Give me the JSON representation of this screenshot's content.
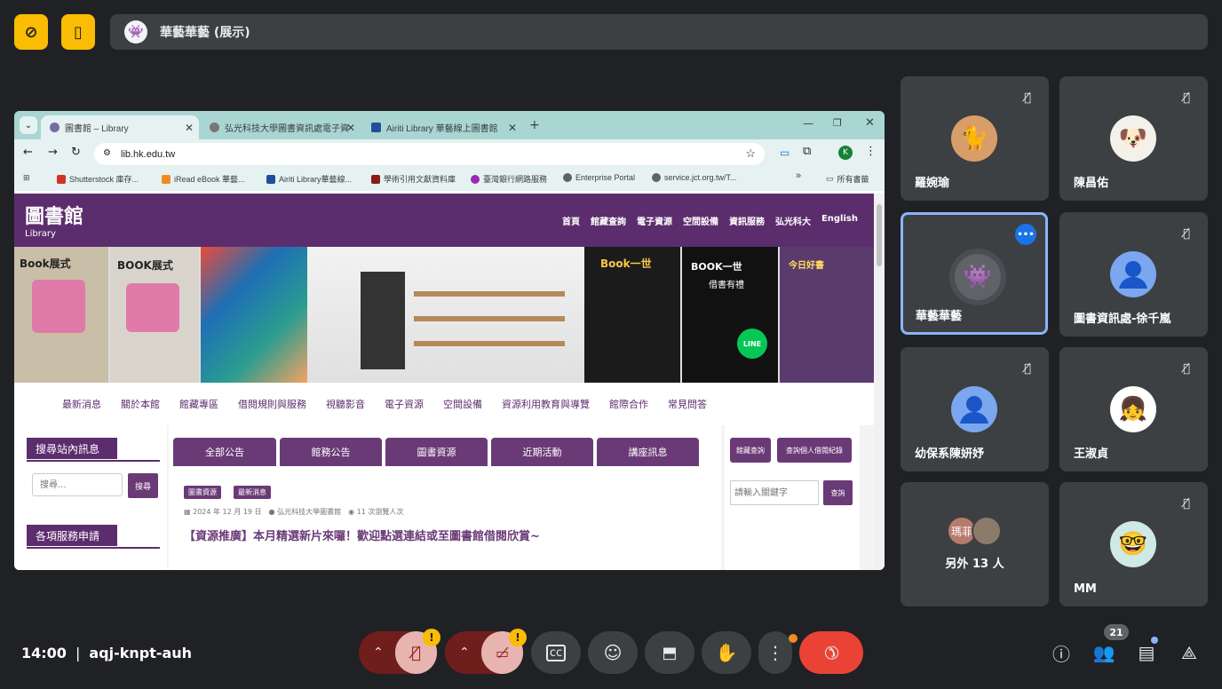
{
  "presenter": {
    "name": "華藝華藝 (展示)"
  },
  "browser": {
    "tabs": [
      {
        "label": "圖書館 – Library"
      },
      {
        "label": "弘光科技大學圖書資訊處電子資"
      },
      {
        "label": "Airiti Library 華藝線上圖書館"
      }
    ],
    "new_tab": "+",
    "url": "lib.hk.edu.tw",
    "bookmarks": [
      "Shutterstock 庫存...",
      "iRead eBook 華藝...",
      "Airiti Library華藝線...",
      "學術引用文獻資料庫",
      "臺灣銀行網路服務",
      "Enterprise Portal",
      "service.jct.org.tw/T..."
    ],
    "bookmarks_more": "»",
    "all_bookmarks": "所有書籤"
  },
  "site": {
    "title": "圖書館",
    "subtitle": "Library",
    "topnav": [
      "首頁",
      "館藏查詢",
      "電子資源",
      "空間設備",
      "資訊服務",
      "弘光科大",
      "English"
    ],
    "subnav": [
      "最新消息",
      "關於本館",
      "館藏專區",
      "借閱規則與服務",
      "視聽影音",
      "電子資源",
      "空間設備",
      "資源利用教育與導覽",
      "館際合作",
      "常見問答"
    ],
    "search_heading": "搜尋站內訊息",
    "search_placeholder": "搜尋...",
    "search_button": "搜尋",
    "services_heading": "各項服務申請",
    "post_tabs": [
      "全部公告",
      "館務公告",
      "圖書資源",
      "近期活動",
      "講座訊息"
    ],
    "post_tags": [
      "圖書資源",
      "最新消息"
    ],
    "post_meta_date": "2024 年 12 月 19 日",
    "post_meta_author": "弘光科技大學圖書館",
    "post_meta_views": "11 次瀏覽人次",
    "post_title": "【資源推廣】本月精選新片來囉！歡迎點選連結或至圖書館借閱欣賞~",
    "right_buttons": [
      "館藏查詢",
      "查詢個人借閱紀錄"
    ],
    "keyword_placeholder": "請輸入關鍵字",
    "query_button": "查詢",
    "banner_texts": {
      "book1": "Book展式",
      "book2": "BOOK展式",
      "book3": "Book一世",
      "book4": "BOOK一世",
      "book4_sub": "借書有禮",
      "line": "LINE",
      "daily": "今日好書"
    }
  },
  "participants": [
    {
      "name": "羅婉瑜",
      "avatar": "cat",
      "muted": true
    },
    {
      "name": "陳昌佑",
      "avatar": "dog",
      "muted": true
    },
    {
      "name": "華藝華藝",
      "avatar": "monster",
      "speaking": true
    },
    {
      "name": "圖書資訊處-徐千嵐",
      "avatar": "default",
      "muted": true
    },
    {
      "name": "幼保系陳妍妤",
      "avatar": "default",
      "muted": true
    },
    {
      "name": "王淑貞",
      "avatar": "girl",
      "muted": true
    },
    {
      "name": "另外 13 人",
      "avatar": "group",
      "group_initials": "瑪菲"
    },
    {
      "name": "MM",
      "avatar": "glasses",
      "muted": true
    }
  ],
  "meeting": {
    "time": "14:00",
    "separator": "|",
    "code": "aqj-knpt-auh"
  },
  "people_count": "21",
  "colors": {
    "accent": "#fbbc04",
    "end_call": "#ea4335",
    "site_purple": "#5c2d6d",
    "speaking": "#8ab4f8"
  }
}
